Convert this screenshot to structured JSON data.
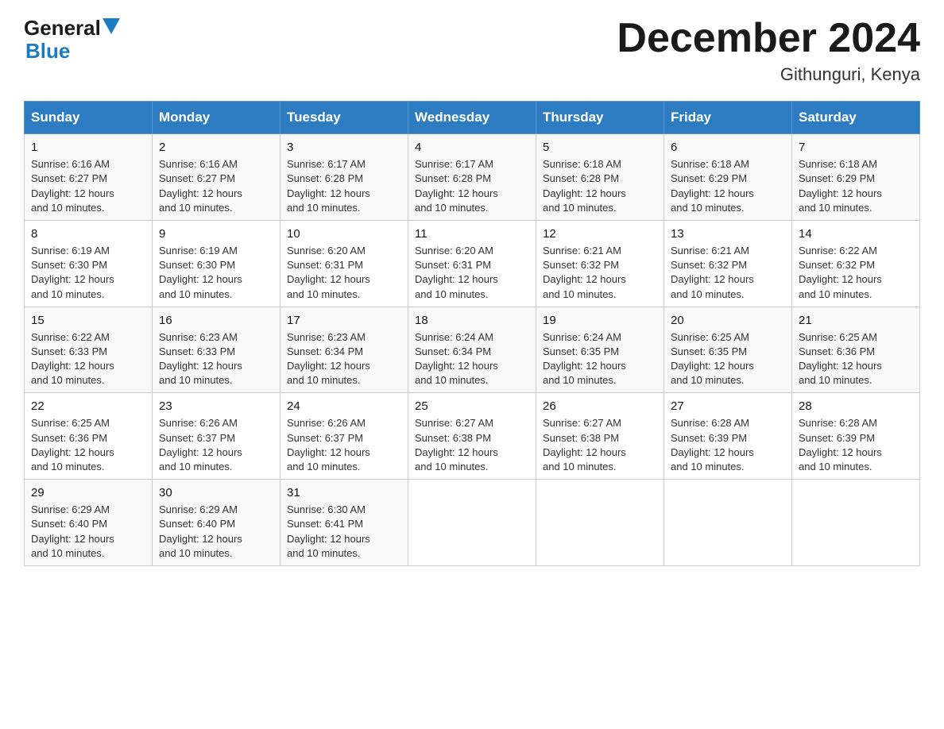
{
  "header": {
    "logo_general": "General",
    "logo_blue": "Blue",
    "month_year": "December 2024",
    "location": "Githunguri, Kenya"
  },
  "days_of_week": [
    "Sunday",
    "Monday",
    "Tuesday",
    "Wednesday",
    "Thursday",
    "Friday",
    "Saturday"
  ],
  "weeks": [
    [
      {
        "day": "1",
        "sunrise": "6:16 AM",
        "sunset": "6:27 PM",
        "daylight": "12 hours and 10 minutes."
      },
      {
        "day": "2",
        "sunrise": "6:16 AM",
        "sunset": "6:27 PM",
        "daylight": "12 hours and 10 minutes."
      },
      {
        "day": "3",
        "sunrise": "6:17 AM",
        "sunset": "6:28 PM",
        "daylight": "12 hours and 10 minutes."
      },
      {
        "day": "4",
        "sunrise": "6:17 AM",
        "sunset": "6:28 PM",
        "daylight": "12 hours and 10 minutes."
      },
      {
        "day": "5",
        "sunrise": "6:18 AM",
        "sunset": "6:28 PM",
        "daylight": "12 hours and 10 minutes."
      },
      {
        "day": "6",
        "sunrise": "6:18 AM",
        "sunset": "6:29 PM",
        "daylight": "12 hours and 10 minutes."
      },
      {
        "day": "7",
        "sunrise": "6:18 AM",
        "sunset": "6:29 PM",
        "daylight": "12 hours and 10 minutes."
      }
    ],
    [
      {
        "day": "8",
        "sunrise": "6:19 AM",
        "sunset": "6:30 PM",
        "daylight": "12 hours and 10 minutes."
      },
      {
        "day": "9",
        "sunrise": "6:19 AM",
        "sunset": "6:30 PM",
        "daylight": "12 hours and 10 minutes."
      },
      {
        "day": "10",
        "sunrise": "6:20 AM",
        "sunset": "6:31 PM",
        "daylight": "12 hours and 10 minutes."
      },
      {
        "day": "11",
        "sunrise": "6:20 AM",
        "sunset": "6:31 PM",
        "daylight": "12 hours and 10 minutes."
      },
      {
        "day": "12",
        "sunrise": "6:21 AM",
        "sunset": "6:32 PM",
        "daylight": "12 hours and 10 minutes."
      },
      {
        "day": "13",
        "sunrise": "6:21 AM",
        "sunset": "6:32 PM",
        "daylight": "12 hours and 10 minutes."
      },
      {
        "day": "14",
        "sunrise": "6:22 AM",
        "sunset": "6:32 PM",
        "daylight": "12 hours and 10 minutes."
      }
    ],
    [
      {
        "day": "15",
        "sunrise": "6:22 AM",
        "sunset": "6:33 PM",
        "daylight": "12 hours and 10 minutes."
      },
      {
        "day": "16",
        "sunrise": "6:23 AM",
        "sunset": "6:33 PM",
        "daylight": "12 hours and 10 minutes."
      },
      {
        "day": "17",
        "sunrise": "6:23 AM",
        "sunset": "6:34 PM",
        "daylight": "12 hours and 10 minutes."
      },
      {
        "day": "18",
        "sunrise": "6:24 AM",
        "sunset": "6:34 PM",
        "daylight": "12 hours and 10 minutes."
      },
      {
        "day": "19",
        "sunrise": "6:24 AM",
        "sunset": "6:35 PM",
        "daylight": "12 hours and 10 minutes."
      },
      {
        "day": "20",
        "sunrise": "6:25 AM",
        "sunset": "6:35 PM",
        "daylight": "12 hours and 10 minutes."
      },
      {
        "day": "21",
        "sunrise": "6:25 AM",
        "sunset": "6:36 PM",
        "daylight": "12 hours and 10 minutes."
      }
    ],
    [
      {
        "day": "22",
        "sunrise": "6:25 AM",
        "sunset": "6:36 PM",
        "daylight": "12 hours and 10 minutes."
      },
      {
        "day": "23",
        "sunrise": "6:26 AM",
        "sunset": "6:37 PM",
        "daylight": "12 hours and 10 minutes."
      },
      {
        "day": "24",
        "sunrise": "6:26 AM",
        "sunset": "6:37 PM",
        "daylight": "12 hours and 10 minutes."
      },
      {
        "day": "25",
        "sunrise": "6:27 AM",
        "sunset": "6:38 PM",
        "daylight": "12 hours and 10 minutes."
      },
      {
        "day": "26",
        "sunrise": "6:27 AM",
        "sunset": "6:38 PM",
        "daylight": "12 hours and 10 minutes."
      },
      {
        "day": "27",
        "sunrise": "6:28 AM",
        "sunset": "6:39 PM",
        "daylight": "12 hours and 10 minutes."
      },
      {
        "day": "28",
        "sunrise": "6:28 AM",
        "sunset": "6:39 PM",
        "daylight": "12 hours and 10 minutes."
      }
    ],
    [
      {
        "day": "29",
        "sunrise": "6:29 AM",
        "sunset": "6:40 PM",
        "daylight": "12 hours and 10 minutes."
      },
      {
        "day": "30",
        "sunrise": "6:29 AM",
        "sunset": "6:40 PM",
        "daylight": "12 hours and 10 minutes."
      },
      {
        "day": "31",
        "sunrise": "6:30 AM",
        "sunset": "6:41 PM",
        "daylight": "12 hours and 10 minutes."
      },
      null,
      null,
      null,
      null
    ]
  ],
  "labels": {
    "sunrise_prefix": "Sunrise: ",
    "sunset_prefix": "Sunset: ",
    "daylight_prefix": "Daylight: "
  }
}
